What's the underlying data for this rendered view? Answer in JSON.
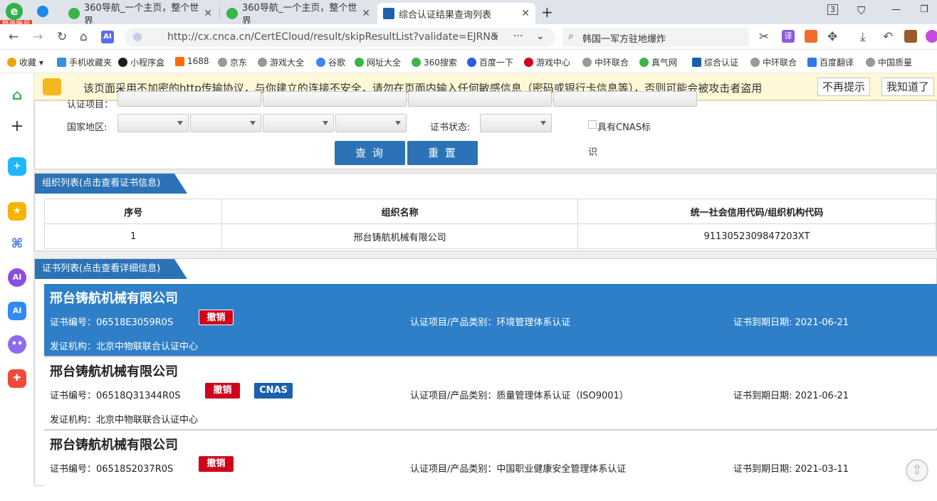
{
  "browser": {
    "login_badge": "登录账号",
    "tabs": [
      {
        "label": "360导航_一个主页，整个世界"
      },
      {
        "label": "360导航_一个主页，整个世界"
      },
      {
        "label": "综合认证结果查询列表"
      }
    ],
    "tab_count": "3",
    "url": "http://cx.cnca.cn/CertECloud/result/skipResultList?validate=EJRN&",
    "search_query": "韩国一军方驻地爆炸",
    "ai_label": "AI",
    "translate_label": "译",
    "bookmarks": [
      {
        "label": "收藏",
        "color": "#f0a30a"
      },
      {
        "label": "手机收藏夹",
        "color": "#3a8ee6"
      },
      {
        "label": "小程序盒",
        "color": "#1e1e1e"
      },
      {
        "label": "1688",
        "color": "#ff6a00"
      },
      {
        "label": "京东",
        "color": "#999999"
      },
      {
        "label": "游戏大全",
        "color": "#999999"
      },
      {
        "label": "谷歌",
        "color": "#4285f4"
      },
      {
        "label": "网址大全",
        "color": "#39b54a"
      },
      {
        "label": "360搜索",
        "color": "#39b54a"
      },
      {
        "label": "百度一下",
        "color": "#2d5be3"
      },
      {
        "label": "游戏中心",
        "color": "#d0021b"
      },
      {
        "label": "中环联合",
        "color": "#999999"
      },
      {
        "label": "真气网",
        "color": "#39b54a"
      },
      {
        "label": "综合认证",
        "color": "#1b5fae"
      },
      {
        "label": "中环联合",
        "color": "#999999"
      },
      {
        "label": "百度翻译",
        "color": "#2d7be3"
      },
      {
        "label": "中国质量",
        "color": "#999999"
      }
    ]
  },
  "sidebar": {
    "items": [
      {
        "icon": "home-icon",
        "color": "#2fb24a"
      },
      {
        "icon": "plus-icon",
        "color": "#333333"
      },
      {
        "icon": "puzzle-icon",
        "color": "#1fb6ff"
      },
      {
        "icon": "star-icon",
        "color": "#f5b400"
      },
      {
        "icon": "network-icon",
        "color": "#3d6ee0"
      },
      {
        "icon": "ai-circle-icon",
        "color": "#8a4fe0"
      },
      {
        "icon": "ai-square-icon",
        "color": "#2f8af5"
      },
      {
        "icon": "chat-bot-icon",
        "color": "#8c6bf0"
      },
      {
        "icon": "gamepad-icon",
        "color": "#f04a3a"
      }
    ]
  },
  "warning": {
    "text": "该页面采用不加密的http传输协议，与你建立的连接不安全，请勿在页面内输入任何敏感信息（密码或银行卡信息等），否则可能会被攻击者盗用",
    "dismiss": "不再提示",
    "ok": "我知道了"
  },
  "form": {
    "cert_project_label": "认证项目：",
    "region_label": "国家地区:",
    "status_label": "证书状态:",
    "cnas_checkbox": "具有CNAS标",
    "cnas_checkbox_wrap": "识",
    "query_button": "查 询",
    "reset_button": "重 置"
  },
  "org_panel": {
    "title": "组织列表(点击查看证书信息)",
    "columns": [
      "序号",
      "组织名称",
      "统一社会信用代码/组织机构代码"
    ],
    "rows": [
      [
        "1",
        "邢台铸航机械有限公司",
        "9113052309847203XT"
      ]
    ]
  },
  "cert_panel": {
    "title": "证书列表(点击查看详细信息)",
    "cards": [
      {
        "company": "邢台铸航机械有限公司",
        "cert_no": "证书编号：06518E3059R0S",
        "status": "撤销",
        "cnas": "",
        "project": "认证项目/产品类别：环境管理体系认证",
        "expiry": "证书到期日期: 2021-06-21",
        "issuer": "发证机构：北京中物联联合认证中心"
      },
      {
        "company": "邢台铸航机械有限公司",
        "cert_no": "证书编号：06518Q31344R0S",
        "status": "撤销",
        "cnas": "CNAS",
        "project": "认证项目/产品类别：质量管理体系认证（ISO9001）",
        "expiry": "证书到期日期: 2021-06-21",
        "issuer": "发证机构：北京中物联联合认证中心"
      },
      {
        "company": "邢台铸航机械有限公司",
        "cert_no": "证书编号：06518S2037R0S",
        "status": "撤销",
        "cnas": "",
        "project": "认证项目/产品类别：中国职业健康安全管理体系认证",
        "expiry": "证书到期日期: 2021-03-11",
        "issuer": ""
      }
    ]
  }
}
